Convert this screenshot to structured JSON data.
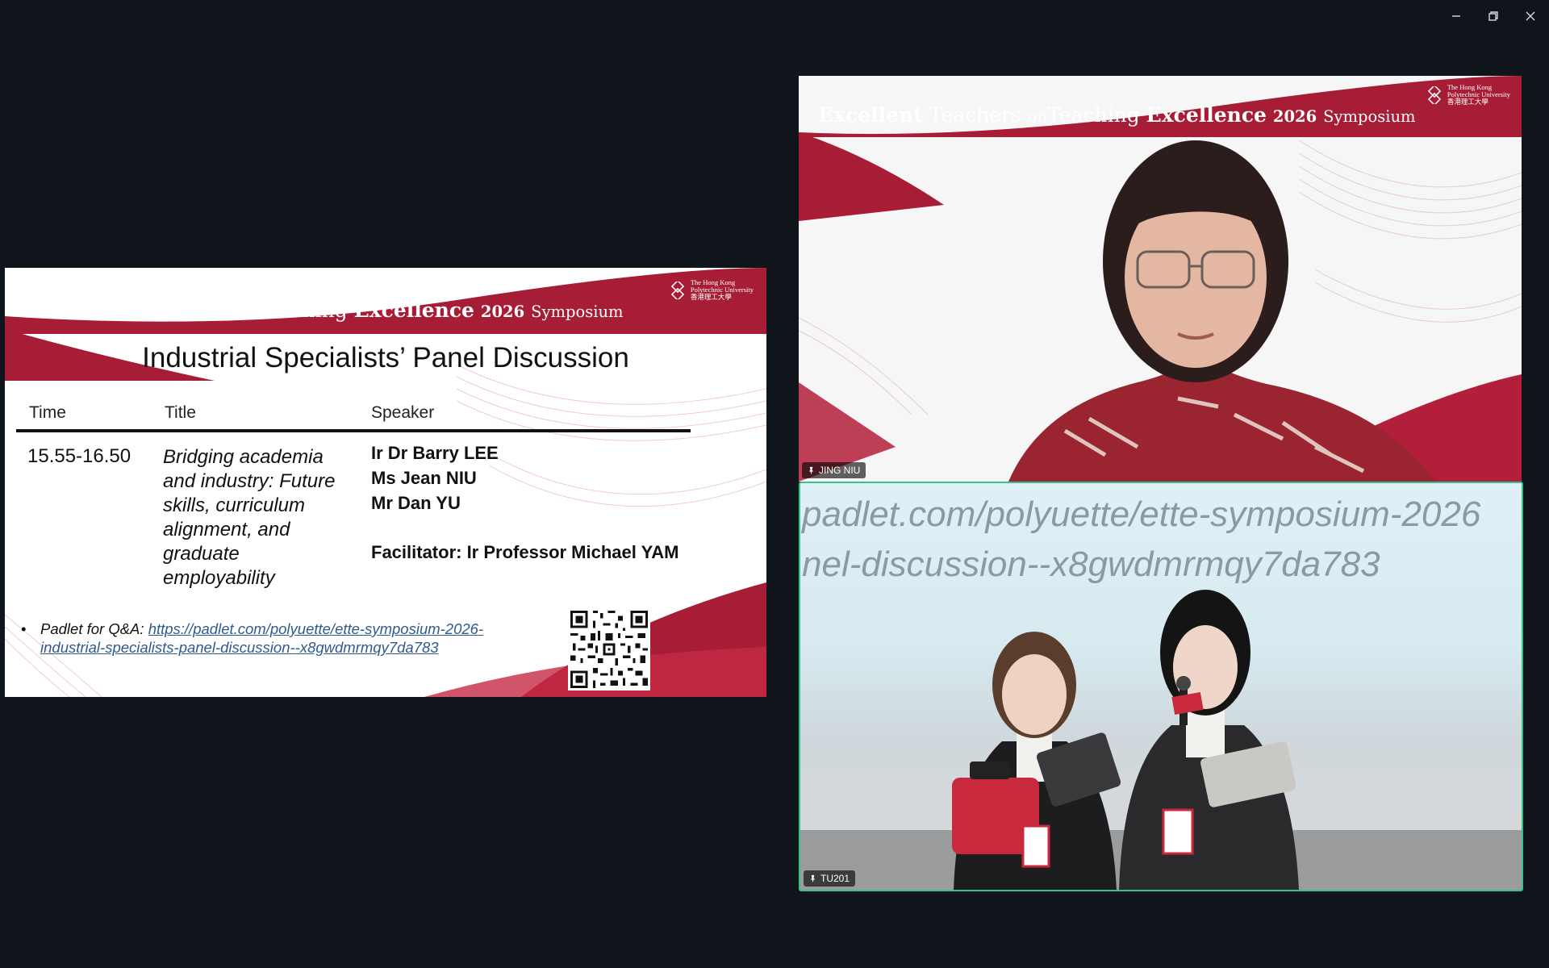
{
  "slide": {
    "banner": {
      "w1": "Excellent",
      "w2": "Teachers",
      "w3": "on",
      "w4": "Teaching",
      "w5": "Excellence",
      "w6": "2026",
      "w7": "Symposium"
    },
    "logo_lines": [
      "The Hong Kong",
      "Polytechnic University",
      "香港理工大學"
    ],
    "heading": "Industrial Specialists’ Panel Discussion",
    "table_headers": [
      "Time",
      "Title",
      "Speaker"
    ],
    "row": {
      "time": "15.55-16.50",
      "title": "Bridging academia and industry: Future skills, curriculum alignment, and graduate employability",
      "speakers": [
        "Ir Dr Barry LEE",
        "Ms Jean NIU",
        "Mr Dan YU"
      ],
      "facilitator": "Facilitator: Ir Professor Michael YAM"
    },
    "padlet_label": "Padlet for Q&A:",
    "padlet_url": "https://padlet.com/polyuette/ette-symposium-2026-industrial-specialists-panel-discussion--x8gwdmrmqy7da783",
    "bullet": "•"
  },
  "participants": [
    {
      "name": "JING NIU"
    },
    {
      "name": "TU201"
    }
  ],
  "projection_text": [
    "padlet.com/polyuette/ette-symposium-2026",
    "nel-discussion--x8gwdmrmqy7da783"
  ],
  "colors": {
    "brand_red": "#a81d36",
    "active_speaker": "#35c38a",
    "background": "#10141b"
  }
}
